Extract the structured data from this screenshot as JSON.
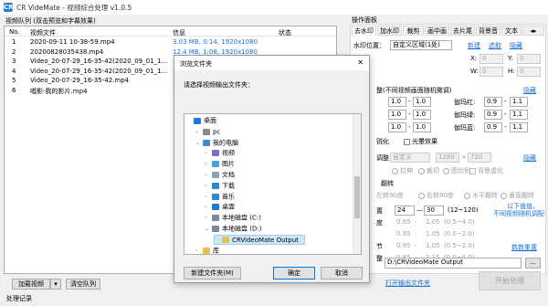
{
  "app": {
    "icon_text": "CR",
    "title": "CR VideMate - 视频综合处理 v1.0.5"
  },
  "queue": {
    "header_label": "视频队列 (双击预览和字幕效果)",
    "columns": [
      "No.",
      "视频文件",
      "信息",
      "状态"
    ],
    "rows": [
      {
        "no": "1",
        "file": "2020-09-11 10-38-59.mp4",
        "info": "3.03 MB, 0:14, 1920x1080"
      },
      {
        "no": "2",
        "file": "20200828035438.mp4",
        "info": "12.4 MB, 1:08, 1920x1080"
      },
      {
        "no": "3",
        "file": "Video_20-07-29_16-35-42(2020_09_01_1...",
        "info": "12.4 MB, 1:08, 1280x720"
      },
      {
        "no": "4",
        "file": "Video_20-07-29_16-35-42(2020_09_01_1...",
        "info": "12.4 MB, 1:08, 1280x720"
      },
      {
        "no": "5",
        "file": "Video_20-07-29_16-35-42.mp4",
        "info": "12.4 MB, 1:08, 1280x720"
      },
      {
        "no": "6",
        "file": "唱影-我的影片.mp4",
        "info": "12.4 MB, 1:08, 1280x720"
      }
    ],
    "add_button": "加载视频",
    "add_dropdown": "▾",
    "clear_button": "清空队列"
  },
  "log_label": "处理记录",
  "panel": {
    "header": "操作面板",
    "tabs": [
      "去水印",
      "加水印",
      "裁剪",
      "画中画",
      "去片尾",
      "背景音",
      "文本"
    ],
    "more_tabs_arrows": "◂▸",
    "watermark_label": "水印位置：",
    "watermark_mode": "自定义区域(1处)",
    "new_link": "新建",
    "pick_link": "选取",
    "hide_link": "隐藏",
    "x_label": "X:",
    "y_label": "Y:",
    "w_label": "W:",
    "h_label": "H:",
    "zero": "0",
    "random_note": "整(不同视频画面随机微调)",
    "hide_link2": "隐藏",
    "adjust_rows": [
      {
        "a": "1.0",
        "b": "1.0",
        "gamma_label": "伽玛红:",
        "g1": "0.9",
        "g2": "1.1"
      },
      {
        "a": "1.0",
        "b": "1.0",
        "gamma_label": "伽玛绿:",
        "g1": "0.9",
        "g2": "1.1"
      },
      {
        "a": "1.0",
        "b": "1.0",
        "gamma_label": "伽玛蓝:",
        "g1": "0.9",
        "g2": "1.1"
      }
    ],
    "sharpen_label": "锐化",
    "bright_effect": "光暈效果",
    "resize_label": "调整",
    "resize_mode": "自定义",
    "width": "1280",
    "times": "×",
    "height": "720",
    "hide_link3": "隐藏",
    "fill_options": [
      "拉伸",
      "裁切",
      "图比例",
      "背景虚化"
    ],
    "flip_label": "翻转",
    "rotate_options": [
      "左转90度",
      "右转90度",
      "水平翻转",
      "垂直翻转"
    ],
    "fps_label": "置",
    "fps_min": "24",
    "fps_dash": "—",
    "fps_max": "30",
    "fps_range": "(12~120)",
    "random_note2": "以下值值，\n不同视频随机调配",
    "rate_rows": [
      {
        "key": "度",
        "a": "0.95",
        "b": "1.05",
        "range": "(0.5~4.0)"
      },
      {
        "key": "",
        "a": "0.95",
        "b": "1.05",
        "range": "(0.0~2.0)"
      },
      {
        "key": "节",
        "a": "0.95",
        "b": "1.05",
        "range": "(0.5~2.0)"
      },
      {
        "key": "整",
        "a": "0.85",
        "b": "1.15",
        "range": "(0.0~4.0)"
      }
    ],
    "reset_link": "数数重置",
    "output_path": "D:\\CRVideoMate Output",
    "browse": "...",
    "open_output_link": "打开输出文件夹",
    "start_button": "开始处理"
  },
  "dialog": {
    "title": "浏览文件夹",
    "close": "✕",
    "prompt": "请选择视频输出文件夹：",
    "tree": [
      {
        "label": "桌面",
        "icon": "desktop-icon",
        "color": "#1f7ad6",
        "indent": 0,
        "chevron": ""
      },
      {
        "label": "pc",
        "icon": "user-icon",
        "color": "#8a8a8a",
        "indent": 1,
        "chevron": "›"
      },
      {
        "label": "我的电脑",
        "icon": "computer-icon",
        "color": "#3c8dd0",
        "indent": 1,
        "chevron": "⌄"
      },
      {
        "label": "视频",
        "icon": "video-folder-icon",
        "color": "#7f6ec7",
        "indent": 2,
        "chevron": "›"
      },
      {
        "label": "图片",
        "icon": "pictures-folder-icon",
        "color": "#4aa3df",
        "indent": 2,
        "chevron": "›"
      },
      {
        "label": "文档",
        "icon": "documents-folder-icon",
        "color": "#8fa3b8",
        "indent": 2,
        "chevron": "›"
      },
      {
        "label": "下载",
        "icon": "download-icon",
        "color": "#2f86d4",
        "indent": 2,
        "chevron": "›"
      },
      {
        "label": "音乐",
        "icon": "music-icon",
        "color": "#2f86d4",
        "indent": 2,
        "chevron": "›"
      },
      {
        "label": "桌面",
        "icon": "desktop-icon",
        "color": "#1f7ad6",
        "indent": 2,
        "chevron": "›"
      },
      {
        "label": "本地磁盘 (C:)",
        "icon": "drive-icon",
        "color": "#7a8a99",
        "indent": 2,
        "chevron": "›"
      },
      {
        "label": "本地磁盘 (D:)",
        "icon": "drive-icon",
        "color": "#7a8a99",
        "indent": 2,
        "chevron": "⌄"
      },
      {
        "label": "CRVideoMate Output",
        "icon": "folder-icon",
        "color": "#e8c04a",
        "indent": 3,
        "chevron": "",
        "selected": true
      },
      {
        "label": "库",
        "icon": "library-icon",
        "color": "#e8c04a",
        "indent": 1,
        "chevron": "›"
      }
    ],
    "new_folder": "新建文件夹(M)",
    "ok": "确定",
    "cancel": "取消"
  }
}
